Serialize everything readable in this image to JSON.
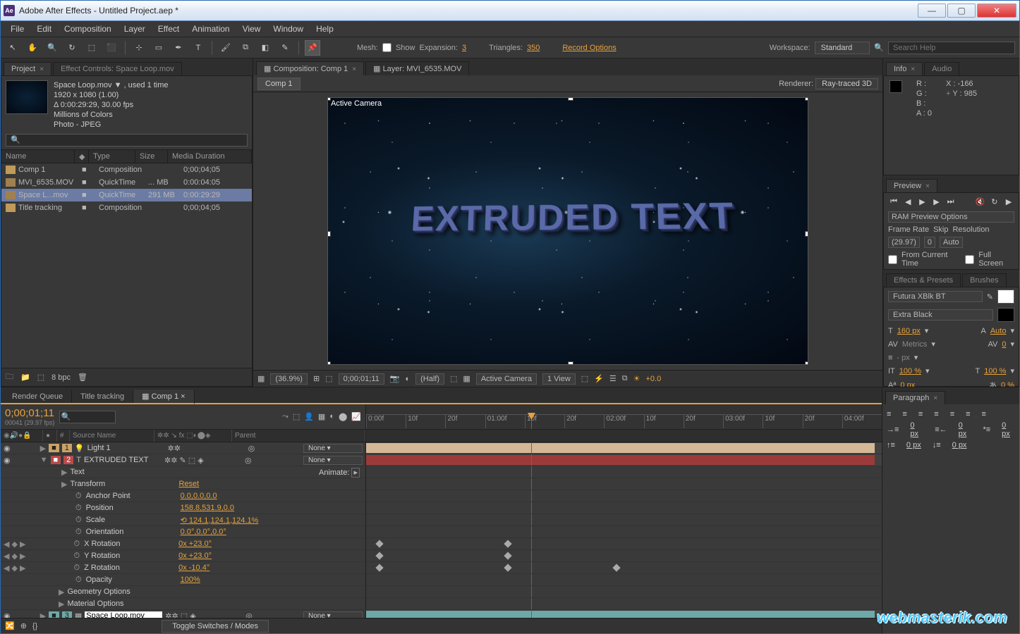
{
  "window": {
    "title": "Adobe After Effects - Untitled Project.aep *"
  },
  "menu": [
    "File",
    "Edit",
    "Composition",
    "Layer",
    "Effect",
    "Animation",
    "View",
    "Window",
    "Help"
  ],
  "toolbar": {
    "mesh_label": "Mesh:",
    "show_label": "Show",
    "expansion_label": "Expansion:",
    "expansion_val": "3",
    "triangles_label": "Triangles:",
    "triangles_val": "350",
    "record_label": "Record Options",
    "workspace_label": "Workspace:",
    "workspace_val": "Standard",
    "search_placeholder": "Search Help"
  },
  "project": {
    "tab": "Project",
    "effect_tab": "Effect Controls: Space Loop.mov",
    "meta": {
      "name": "Space Loop.mov ▼ , used 1 time",
      "dims": "1920 x 1080 (1.00)",
      "dur": "Δ 0:00:29:29, 30.00 fps",
      "colors": "Millions of Colors",
      "codec": "Photo - JPEG"
    },
    "search_icon": "🔍",
    "columns": {
      "name": "Name",
      "label": "",
      "type": "Type",
      "size": "Size",
      "dur": "Media Duration"
    },
    "col_widths": {
      "name": 104,
      "label": 20,
      "type": 66,
      "size": 46,
      "dur": 80
    },
    "items": [
      {
        "name": "Comp 1",
        "type": "Composition",
        "size": "",
        "dur": "0;00;04;05",
        "sel": false,
        "kind": "comp"
      },
      {
        "name": "MVI_6535.MOV",
        "type": "QuickTime",
        "size": "... MB",
        "dur": "0:00:04:05",
        "sel": false,
        "kind": "mov"
      },
      {
        "name": "Space L...mov",
        "type": "QuickTime",
        "size": "291 MB",
        "dur": "0:00:29:29",
        "sel": true,
        "kind": "mov"
      },
      {
        "name": "Title tracking",
        "type": "Composition",
        "size": "",
        "dur": "0;00;04;05",
        "sel": false,
        "kind": "comp"
      }
    ],
    "footer_bpc": "8 bpc"
  },
  "comp": {
    "tab_comp": "Composition: Comp 1",
    "tab_layer": "Layer: MVI_6535.MOV",
    "breadcrumb": "Comp 1",
    "renderer_label": "Renderer:",
    "renderer_val": "Ray-traced 3D",
    "camera_label": "Active Camera",
    "extruded_text": "EXTRUDED TEXT",
    "footer": {
      "zoom": "(36.9%)",
      "time": "0;00;01;11",
      "res": "(Half)",
      "cam": "Active Camera",
      "views": "1 View",
      "exposure": "+0.0"
    }
  },
  "info": {
    "tab_info": "Info",
    "tab_audio": "Audio",
    "r": "R :",
    "g": "G :",
    "b": "B :",
    "a": "A : 0",
    "x": "X : -166",
    "y": "Y : 985"
  },
  "preview": {
    "tab": "Preview",
    "ram_label": "RAM Preview Options",
    "framerate_label": "Frame Rate",
    "skip_label": "Skip",
    "res_label": "Resolution",
    "framerate_val": "(29.97)",
    "skip_val": "0",
    "res_val": "Auto",
    "from_current": "From Current Time",
    "fullscreen": "Full Screen"
  },
  "effects_tab": "Effects & Presets",
  "brushes_tab": "Brushes",
  "character": {
    "font": "Futura XBlk BT",
    "style": "Extra Black",
    "size": "160 px",
    "leading": "Auto",
    "kerning": "Metrics",
    "tracking": "0",
    "stroke": "- px",
    "vscale": "100 %",
    "hscale": "100 %",
    "baseline": "0 px",
    "tsume": "0 %"
  },
  "timeline": {
    "tabs": [
      "Render Queue",
      "Title tracking",
      "Comp 1"
    ],
    "active_tab": 2,
    "timecode": "0;00;01;11",
    "subframe": "00041 (29.97 fps)",
    "ruler": [
      "0:00f",
      "10f",
      "20f",
      "01:00f",
      "10f",
      "20f",
      "02:00f",
      "10f",
      "20f",
      "03:00f",
      "10f",
      "20f",
      "04:00f"
    ],
    "col_source": "Source Name",
    "col_parent": "Parent",
    "animate_label": "Animate: ",
    "layers": [
      {
        "num": "1",
        "name": "Light 1",
        "parent": "None",
        "kind": "light",
        "badge": "light"
      },
      {
        "num": "2",
        "name": "EXTRUDED TEXT",
        "parent": "None",
        "kind": "text",
        "badge": "r"
      },
      {
        "num": "3",
        "name": "Space Loop.mov",
        "parent": "None",
        "kind": "footage",
        "badge": "t"
      }
    ],
    "props": [
      {
        "name": "Text",
        "val": ""
      },
      {
        "name": "Transform",
        "val": "Reset"
      },
      {
        "name": "Anchor Point",
        "val": "0.0,0.0,0.0",
        "sw": true
      },
      {
        "name": "Position",
        "val": "158.8,531.9,0.0",
        "sw": true
      },
      {
        "name": "Scale",
        "val": "⟲ 124.1,124.1,124.1%",
        "sw": true
      },
      {
        "name": "Orientation",
        "val": "0.0°,0.0°,0.0°",
        "sw": true
      },
      {
        "name": "X Rotation",
        "val": "0x +23.0°",
        "sw": true,
        "kf": true,
        "nav": true
      },
      {
        "name": "Y Rotation",
        "val": "0x +23.0°",
        "sw": true,
        "kf": true,
        "nav": true
      },
      {
        "name": "Z Rotation",
        "val": "0x -10.4°",
        "sw": true,
        "kf": true,
        "nav": true
      },
      {
        "name": "Opacity",
        "val": "100%",
        "sw": true
      }
    ],
    "geo": "Geometry Options",
    "mat": "Material Options",
    "toggle": "Toggle Switches / Modes"
  },
  "paragraph": {
    "tab": "Paragraph",
    "indent_left": "0 px",
    "indent_right": "0 px",
    "indent_first": "0 px",
    "space_before": "0 px",
    "space_after": "0 px"
  },
  "watermark": "webmasterik.com"
}
